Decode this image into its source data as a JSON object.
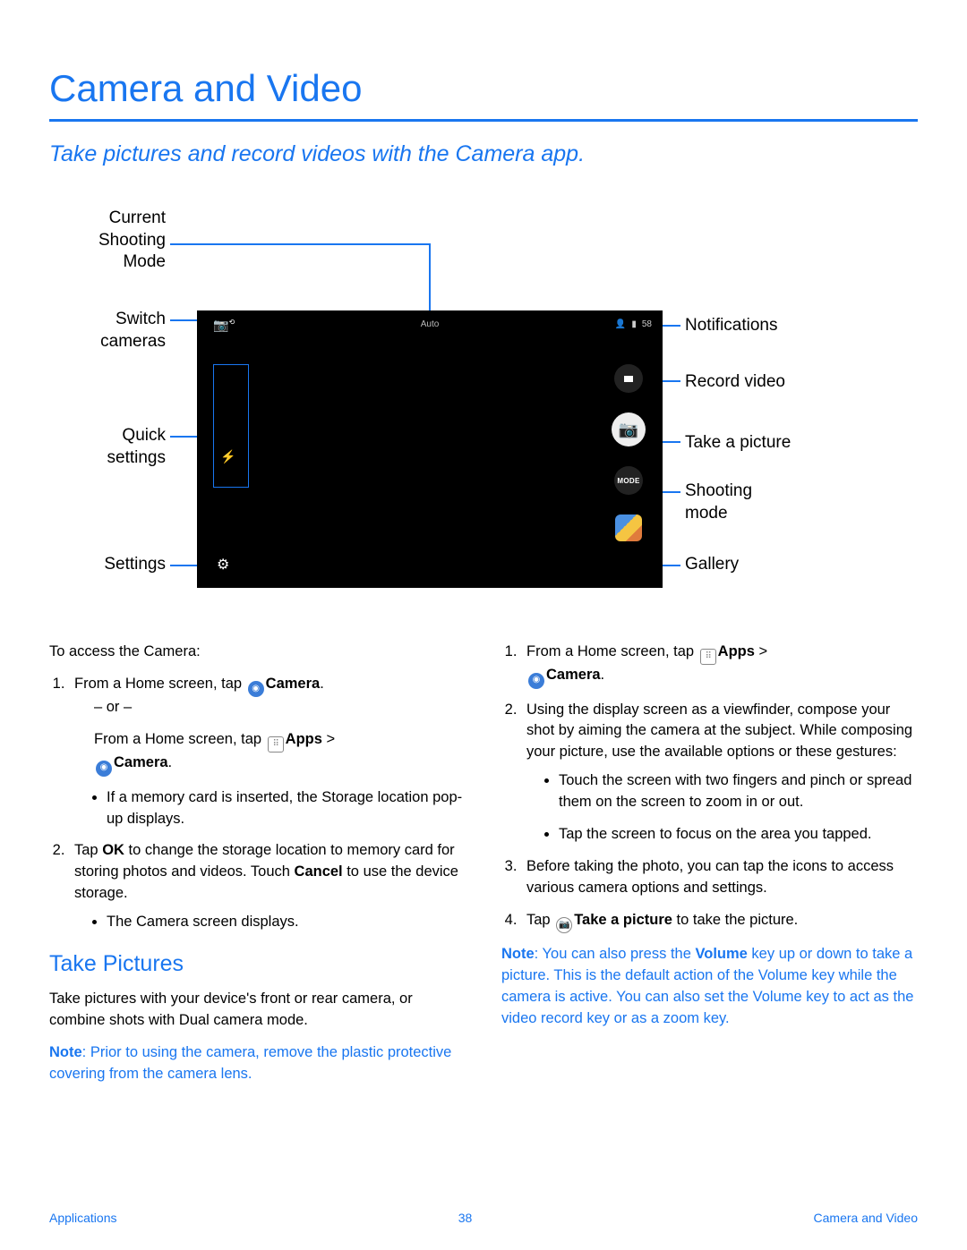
{
  "title": "Camera and Video",
  "subtitle": "Take pictures and record videos with the Camera app.",
  "diagram": {
    "left_labels": {
      "current_mode": "Current\nShooting\nMode",
      "switch": "Switch\ncameras",
      "quick": "Quick\nsettings",
      "settings": "Settings"
    },
    "right_labels": {
      "notifications": "Notifications",
      "record": "Record video",
      "take": "Take a picture",
      "mode": "Shooting\nmode",
      "gallery": "Gallery"
    },
    "camera_ui": {
      "mode_text": "Auto",
      "switch_icon": "⟲",
      "notif_count": "58",
      "flash_icon": "⚡",
      "gear_icon": "⚙",
      "video_icon": "■",
      "shutter_icon": "📷",
      "mode_btn": "MODE"
    }
  },
  "col1": {
    "intro": "To access the Camera:",
    "step1_a": "From a Home screen, tap ",
    "step1_b": "Camera",
    "or": "– or –",
    "step1_c": "From a Home screen, tap ",
    "apps": "Apps",
    "gt": " > ",
    "camera_word": "Camera",
    "bullet1": "If a memory card is inserted, the Storage location pop-up displays.",
    "step2_a": "Tap ",
    "ok": "OK",
    "step2_b": " to change the storage location to memory card for storing photos and videos. Touch ",
    "cancel": "Cancel",
    "step2_c": " to use the device storage.",
    "bullet2": "The Camera screen displays.",
    "take_pictures_hdr": "Take Pictures",
    "take_pictures_p": "Take pictures with your device's front or rear camera, or combine shots with Dual camera mode.",
    "note1_a": "Note",
    "note1_b": ": Prior to using the camera, remove the plastic protective covering from the camera lens."
  },
  "col2": {
    "step1_a": "From a Home screen, tap ",
    "apps": "Apps",
    "gt": " > ",
    "camera_word": "Camera",
    "step2": "Using the display screen as a viewfinder, compose your shot by aiming the camera at the subject. While composing your picture, use the available options or these gestures:",
    "b1": "Touch the screen with two fingers and pinch or spread them on the screen to zoom in or out.",
    "b2": "Tap the screen to focus on the area you tapped.",
    "step3": "Before taking the photo, you can tap the icons to access various camera options and settings.",
    "step4_a": "Tap ",
    "step4_b": "Take a picture",
    "step4_c": " to take the picture.",
    "note2_a": "Note",
    "note2_b": ": You can also press the ",
    "volume": "Volume",
    "note2_c": " key up or down to take a picture. This is the default action of the Volume key while the camera is active. You can also set the Volume key to act as the video record key or as a zoom key."
  },
  "footer": {
    "left": "Applications",
    "page": "38",
    "right": "Camera and Video"
  }
}
